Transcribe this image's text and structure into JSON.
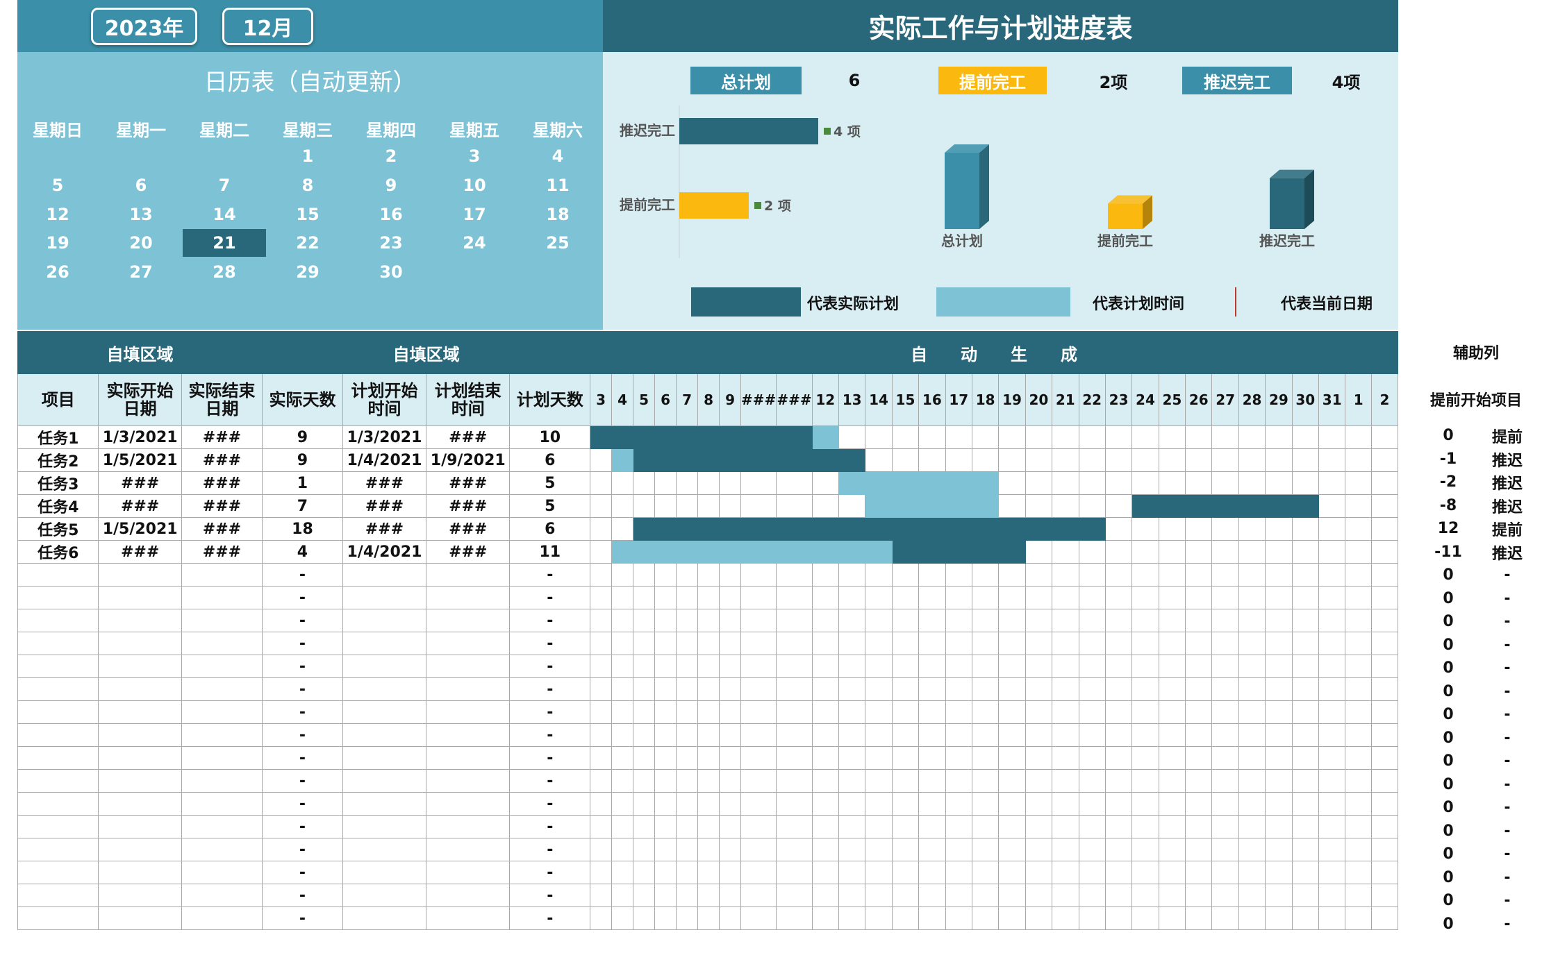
{
  "header": {
    "year": "2023年",
    "month": "12月",
    "title": "实际工作与计划进度表"
  },
  "calendar": {
    "title": "日历表（自动更新）",
    "weekdays": [
      "星期日",
      "星期一",
      "星期二",
      "星期三",
      "星期四",
      "星期五",
      "星期六"
    ],
    "weeks": [
      [
        "",
        "",
        "",
        "1",
        "2",
        "3",
        "4"
      ],
      [
        "5",
        "6",
        "7",
        "8",
        "9",
        "10",
        "11"
      ],
      [
        "12",
        "13",
        "14",
        "15",
        "16",
        "17",
        "18"
      ],
      [
        "19",
        "20",
        "21",
        "22",
        "23",
        "24",
        "25"
      ],
      [
        "26",
        "27",
        "28",
        "29",
        "30",
        "",
        ""
      ]
    ],
    "selected": "21"
  },
  "summary": {
    "total_label": "总计划",
    "total_value": "6",
    "early_label": "提前完工",
    "early_value": "2项",
    "late_label": "推迟完工",
    "late_value": "4项"
  },
  "colors": {
    "dark": "#29687a",
    "mid": "#3b8fa8",
    "light": "#7ec2d6",
    "pale": "#d8eef3",
    "yellow": "#fbb80f",
    "green": "#4a8a3c",
    "red": "#c0392b"
  },
  "chart_data": [
    {
      "type": "bar",
      "orientation": "horizontal",
      "categories": [
        "推迟完工",
        "提前完工"
      ],
      "values": [
        4,
        2
      ],
      "data_labels": [
        "4 项",
        "2 项"
      ],
      "colors": [
        "#29687a",
        "#fbb80f"
      ]
    },
    {
      "type": "bar",
      "style": "3d-column",
      "categories": [
        "总计划",
        "提前完工",
        "推迟完工"
      ],
      "values": [
        6,
        2,
        4
      ],
      "colors": [
        "#3b8fa8",
        "#fbb80f",
        "#29687a"
      ]
    }
  ],
  "legend": {
    "actual": "代表实际计划",
    "planned": "代表计划时间",
    "today": "代表当前日期"
  },
  "table": {
    "group_headers": {
      "self_fill_a": "自填区域",
      "self_fill_b": "自填区域",
      "auto": "自　　动　　生　　成"
    },
    "col_headers": [
      "项目",
      "实际开始日期",
      "实际结束日期",
      "实际天数",
      "计划开始时间",
      "计划结束时间",
      "计划天数"
    ],
    "day_headers": [
      "3",
      "4",
      "5",
      "6",
      "7",
      "8",
      "9",
      "###",
      "###",
      "12",
      "13",
      "14",
      "15",
      "16",
      "17",
      "18",
      "19",
      "20",
      "21",
      "22",
      "23",
      "24",
      "25",
      "26",
      "27",
      "28",
      "29",
      "30",
      "31",
      "1",
      "2"
    ],
    "rows": [
      {
        "name": "任务1",
        "a_start": "1/3/2021",
        "a_end": "###",
        "a_days": "9",
        "p_start": "1/3/2021",
        "p_end": "###",
        "p_days": "10",
        "help_num": "0",
        "help_txt": "提前"
      },
      {
        "name": "任务2",
        "a_start": "1/5/2021",
        "a_end": "###",
        "a_days": "9",
        "p_start": "1/4/2021",
        "p_end": "1/9/2021",
        "p_days": "6",
        "help_num": "-1",
        "help_txt": "推迟"
      },
      {
        "name": "任务3",
        "a_start": "###",
        "a_end": "###",
        "a_days": "1",
        "p_start": "###",
        "p_end": "###",
        "p_days": "5",
        "help_num": "-2",
        "help_txt": "推迟"
      },
      {
        "name": "任务4",
        "a_start": "###",
        "a_end": "###",
        "a_days": "7",
        "p_start": "###",
        "p_end": "###",
        "p_days": "5",
        "help_num": "-8",
        "help_txt": "推迟"
      },
      {
        "name": "任务5",
        "a_start": "1/5/2021",
        "a_end": "###",
        "a_days": "18",
        "p_start": "###",
        "p_end": "###",
        "p_days": "6",
        "help_num": "12",
        "help_txt": "提前"
      },
      {
        "name": "任务6",
        "a_start": "###",
        "a_end": "###",
        "a_days": "4",
        "p_start": "1/4/2021",
        "p_end": "###",
        "p_days": "11",
        "help_num": "-11",
        "help_txt": "推迟"
      }
    ],
    "blank_rows": 16,
    "dash": "-",
    "zero": "0",
    "gantt": [
      {
        "actual": [
          0,
          8
        ],
        "plan": [
          9,
          9
        ]
      },
      {
        "actual": [
          2,
          10
        ],
        "plan": [
          1,
          1
        ]
      },
      {
        "actual": [
          12,
          12
        ],
        "plan": [
          10,
          15
        ]
      },
      {
        "actual": [
          21,
          27
        ],
        "plan": [
          11,
          15
        ]
      },
      {
        "actual": [
          2,
          19
        ],
        "plan": null
      },
      {
        "actual": [
          12,
          16
        ],
        "plan": [
          1,
          11
        ]
      }
    ]
  },
  "helper": {
    "header1": "辅助列",
    "header2": "提前开始项目"
  }
}
